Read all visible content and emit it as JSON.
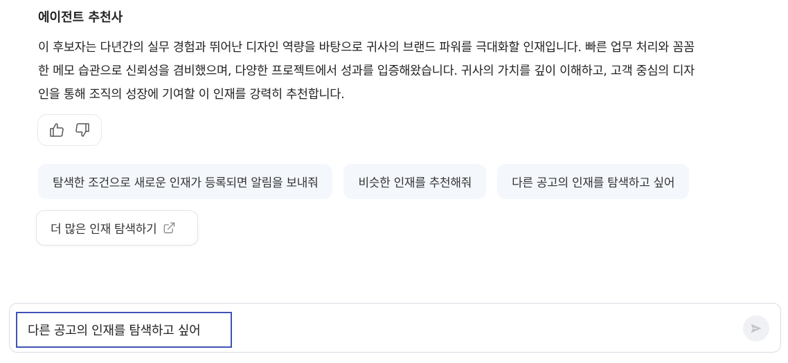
{
  "agent": {
    "name": "에이전트 추천사"
  },
  "message": {
    "lines": [
      "이 후보자는 다년간의 실무 경험과 뛰어난 디자인 역량을 바탕으로 귀사의 브랜드 파워를 극대화할 인재입니다. 빠른 업무 처리와 꼼꼼",
      "한 메모 습관으로 신뢰성을 겸비했으며, 다양한 프로젝트에서 성과를 입증해왔습니다. 귀사의 가치를 깊이 이해하고, 고객 중심의 디자",
      "인을 통해 조직의 성장에 기여할 이 인재를 강력히 추천합니다."
    ]
  },
  "feedback": {
    "like_icon": "thumbs-up-icon",
    "dislike_icon": "thumbs-down-icon"
  },
  "suggestions": [
    "탐색한 조건으로 새로운 인재가 등록되면 알림을 보내줘",
    "비슷한 인재를 추천해줘",
    "다른 공고의 인재를 탐색하고 싶어"
  ],
  "more": {
    "label": "더 많은 인재 탐색하기",
    "icon": "external-link-icon"
  },
  "composer": {
    "value": "다른 공고의 인재를 탐색하고 싶어",
    "send_icon": "send-icon"
  },
  "colors": {
    "chip_bg": "#f4f7fc",
    "focus_border": "#3f51b5",
    "icon_gray": "#b5b8bf"
  }
}
